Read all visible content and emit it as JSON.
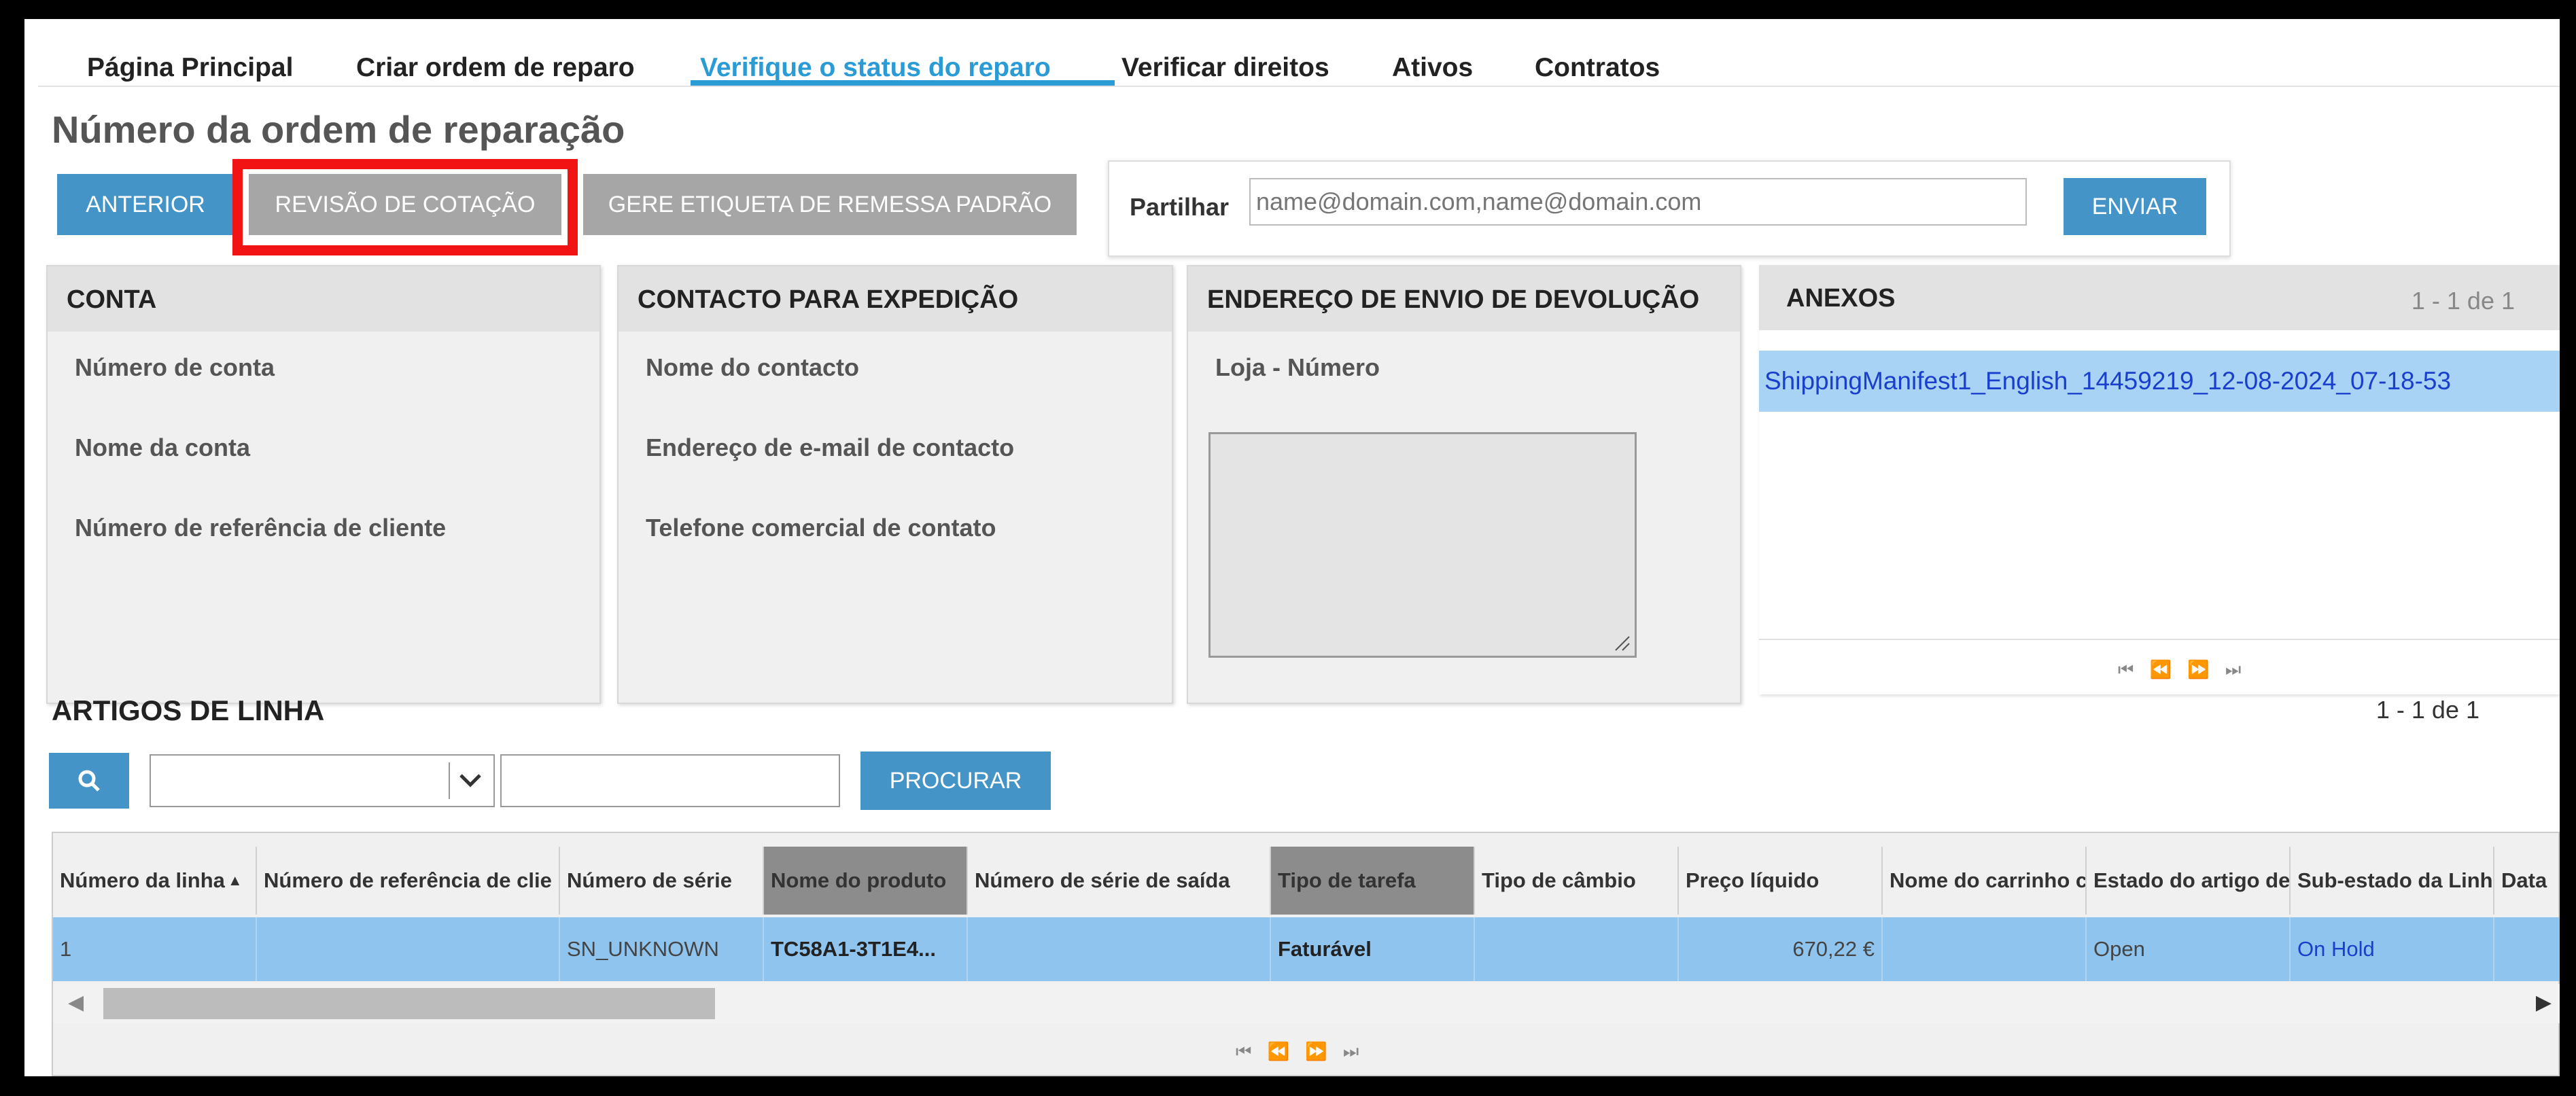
{
  "nav": {
    "items": [
      "Página Principal",
      "Criar ordem de reparo",
      "Verifique o status do reparo",
      "Verificar direitos",
      "Ativos",
      "Contratos"
    ],
    "active_index": 2
  },
  "page_title": "Número da ordem de reparação",
  "toolbar": {
    "anterior": "ANTERIOR",
    "revisao": "REVISÃO DE COTAÇÃO",
    "etiqueta": "GERE ETIQUETA DE REMESSA PADRÃO"
  },
  "share": {
    "label": "Partilhar",
    "placeholder": "name@domain.com,name@domain.com",
    "send": "ENVIAR"
  },
  "panels": {
    "conta": {
      "title": "CONTA",
      "fields": [
        "Número de conta",
        "Nome da conta",
        "Número de referência de cliente"
      ]
    },
    "contacto": {
      "title": "CONTACTO PARA EXPEDIÇÃO",
      "fields": [
        "Nome do contacto",
        "Endereço de e-mail de contacto",
        "Telefone comercial de contato"
      ]
    },
    "endereco": {
      "title": "ENDEREÇO DE ENVIO DE DEVOLUÇÃO",
      "fields": [
        "Loja - Número"
      ]
    }
  },
  "attachments": {
    "title": "ANEXOS",
    "count": "1 - 1 de 1",
    "items": [
      "ShippingManifest1_English_14459219_12-08-2024_07-18-53"
    ]
  },
  "line_items": {
    "title": "ARTIGOS DE LINHA",
    "count": "1 - 1 de 1",
    "search_button": "PROCURAR",
    "columns": [
      "Número da linha",
      "Número de referência de clie",
      "Número de série",
      "Nome do produto",
      "Número de série de saída",
      "Tipo de tarefa",
      "Tipo de câmbio",
      "Preço líquido",
      "Nome do carrinho c",
      "Estado do artigo de",
      "Sub-estado da Linh",
      "Data"
    ],
    "rows": [
      [
        "1",
        "",
        "SN_UNKNOWN",
        "TC58A1-3T1E4...",
        "",
        "Faturável",
        "",
        "670,22 €",
        "",
        "Open",
        "On Hold",
        ""
      ]
    ]
  },
  "colors": {
    "accent": "#2b9bd6",
    "button_blue": "#4594c8",
    "highlight_red": "#f21414",
    "link_blue": "#1a3fcc",
    "row_selected": "#8fc4ef"
  }
}
